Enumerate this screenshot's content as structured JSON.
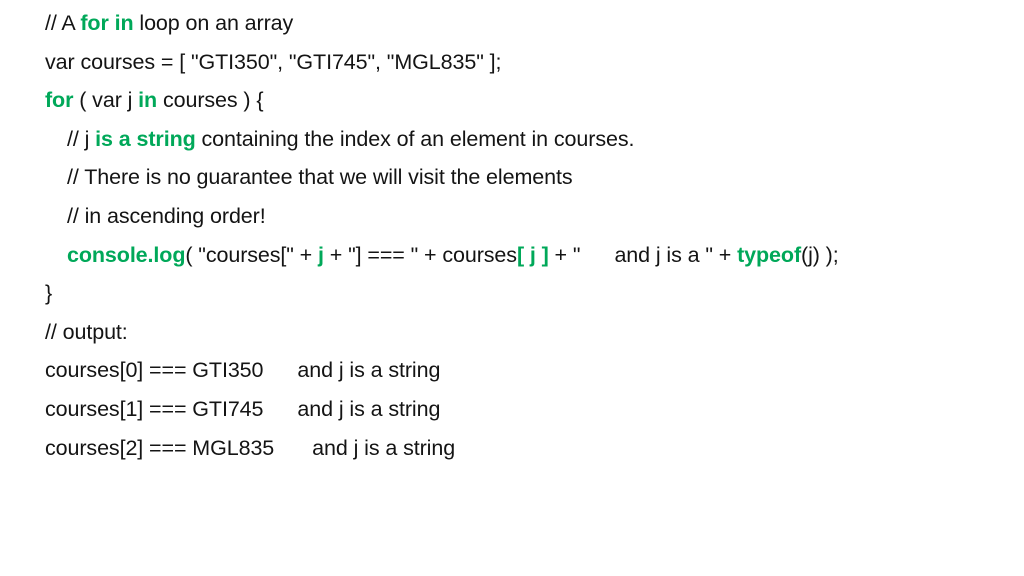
{
  "slide": {
    "title": "for in loop on an array code listing",
    "background_color": "#ffffff",
    "text_color": "#141414",
    "keyword_color": "#00a859",
    "lines": [
      {
        "id": "line-comment-intro",
        "indent": 0,
        "segments": [
          {
            "text": "// A ",
            "kind": "plain"
          },
          {
            "text": "for in",
            "kind": "keyword"
          },
          {
            "text": " loop on an array",
            "kind": "plain"
          }
        ]
      },
      {
        "id": "line-var-courses",
        "indent": 0,
        "segments": [
          {
            "text": "var courses = [ \"GTI350\", \"GTI745\", \"MGL835\" ];",
            "kind": "plain"
          }
        ]
      },
      {
        "id": "line-for-header",
        "indent": 0,
        "segments": [
          {
            "text": "for",
            "kind": "keyword"
          },
          {
            "text": " ( var j ",
            "kind": "plain"
          },
          {
            "text": "in",
            "kind": "keyword"
          },
          {
            "text": " courses ) {",
            "kind": "plain"
          }
        ]
      },
      {
        "id": "line-comment-j-is-string",
        "indent": 1,
        "segments": [
          {
            "text": "// j ",
            "kind": "plain"
          },
          {
            "text": "is a string",
            "kind": "keyword"
          },
          {
            "text": " containing the index of an element in courses.",
            "kind": "plain"
          }
        ]
      },
      {
        "id": "line-comment-no-guarantee",
        "indent": 1,
        "segments": [
          {
            "text": "// There is no guarantee that we will visit the elements",
            "kind": "plain"
          }
        ]
      },
      {
        "id": "line-comment-ascending",
        "indent": 1,
        "segments": [
          {
            "text": "// in ascending order!",
            "kind": "plain"
          }
        ]
      },
      {
        "id": "line-console-log",
        "indent": 1,
        "segments": [
          {
            "text": "console.log",
            "kind": "keyword"
          },
          {
            "text": "( \"courses[\" + ",
            "kind": "plain"
          },
          {
            "text": "j",
            "kind": "keyword"
          },
          {
            "text": " + \"] === \" + courses",
            "kind": "plain"
          },
          {
            "text": "[ j ]",
            "kind": "keyword"
          },
          {
            "text": " + \"",
            "kind": "plain"
          },
          {
            "text": "",
            "kind": "tab"
          },
          {
            "text": "and j is a \" + ",
            "kind": "plain"
          },
          {
            "text": "typeof",
            "kind": "keyword"
          },
          {
            "text": "(j) );",
            "kind": "plain"
          }
        ]
      },
      {
        "id": "line-close-brace",
        "indent": 0,
        "segments": [
          {
            "text": "}",
            "kind": "plain"
          }
        ]
      },
      {
        "id": "line-comment-output",
        "indent": 0,
        "segments": [
          {
            "text": "// output:",
            "kind": "plain"
          }
        ]
      },
      {
        "id": "line-output-0",
        "indent": 0,
        "segments": [
          {
            "text": "courses[0] === GTI350",
            "kind": "plain"
          },
          {
            "text": "",
            "kind": "tab"
          },
          {
            "text": "and j is a string",
            "kind": "plain"
          }
        ]
      },
      {
        "id": "line-output-1",
        "indent": 0,
        "segments": [
          {
            "text": "courses[1] === GTI745",
            "kind": "plain"
          },
          {
            "text": "",
            "kind": "tab"
          },
          {
            "text": "and j is a string",
            "kind": "plain"
          }
        ]
      },
      {
        "id": "line-output-2",
        "indent": 0,
        "segments": [
          {
            "text": "courses[2] === MGL835",
            "kind": "plain"
          },
          {
            "text": "",
            "kind": "tab-wide"
          },
          {
            "text": "and j is a string",
            "kind": "plain"
          }
        ]
      }
    ]
  }
}
